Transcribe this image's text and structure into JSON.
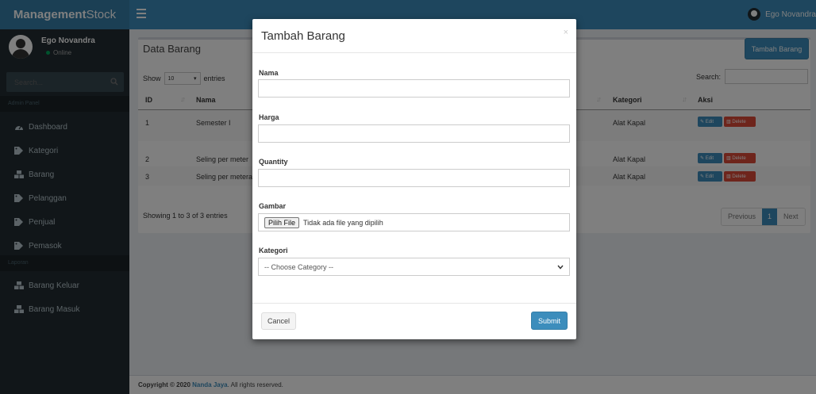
{
  "header": {
    "logo_bold": "Management",
    "logo_thin": "Stock",
    "user_name": "Ego Novandra"
  },
  "sidebar": {
    "user_name": "Ego Novandra",
    "status": "Online",
    "search_placeholder": "Search...",
    "section_admin": "Admin Panel",
    "section_laporan": "Laporan",
    "items": [
      {
        "label": "Dashboard",
        "icon": "dashboard-icon"
      },
      {
        "label": "Kategori",
        "icon": "tag-icon"
      },
      {
        "label": "Barang",
        "icon": "cubes-icon"
      },
      {
        "label": "Pelanggan",
        "icon": "tag-icon"
      },
      {
        "label": "Penjual",
        "icon": "tag-icon"
      },
      {
        "label": "Pemasok",
        "icon": "tag-icon"
      }
    ],
    "report_items": [
      {
        "label": "Barang Keluar",
        "icon": "cubes-icon"
      },
      {
        "label": "Barang Masuk",
        "icon": "cubes-icon"
      }
    ]
  },
  "content": {
    "box_title": "Data Barang",
    "add_button": "Tambah Barang",
    "show_label": "Show",
    "show_value": "10",
    "entries_label": "entries",
    "search_label": "Search:",
    "columns": {
      "id": "ID",
      "nama": "Nama",
      "kategori": "Kategori",
      "aksi": "Aksi"
    },
    "rows": [
      {
        "id": "1",
        "nama": "Semester I",
        "kategori": "Alat Kapal"
      },
      {
        "id": "2",
        "nama": "Seling per meter",
        "kategori": "Alat Kapal"
      },
      {
        "id": "3",
        "nama": "Seling per meteran",
        "kategori": "Alat Kapal"
      }
    ],
    "edit_label": "Edit",
    "delete_label": "Delete",
    "showing_text": "Showing 1 to 3 of 3 entries",
    "pager": {
      "previous": "Previous",
      "page": "1",
      "next": "Next"
    }
  },
  "footer": {
    "prefix": "Copyright © 2020 ",
    "company": "Nanda Jaya",
    "suffix": ". All rights reserved."
  },
  "modal": {
    "title": "Tambah Barang",
    "close": "×",
    "fields": {
      "nama_label": "Nama",
      "harga_label": "Harga",
      "quantity_label": "Quantity",
      "gambar_label": "Gambar",
      "file_button": "Pilih File",
      "file_status": "Tidak ada file yang dipilih",
      "kategori_label": "Kategori",
      "kategori_placeholder": "-- Choose Category --"
    },
    "cancel": "Cancel",
    "submit": "Submit"
  },
  "colors": {
    "primary": "#3c8dbc",
    "sidebar": "#222d32",
    "danger": "#dd4b39",
    "online": "#00a65a"
  }
}
